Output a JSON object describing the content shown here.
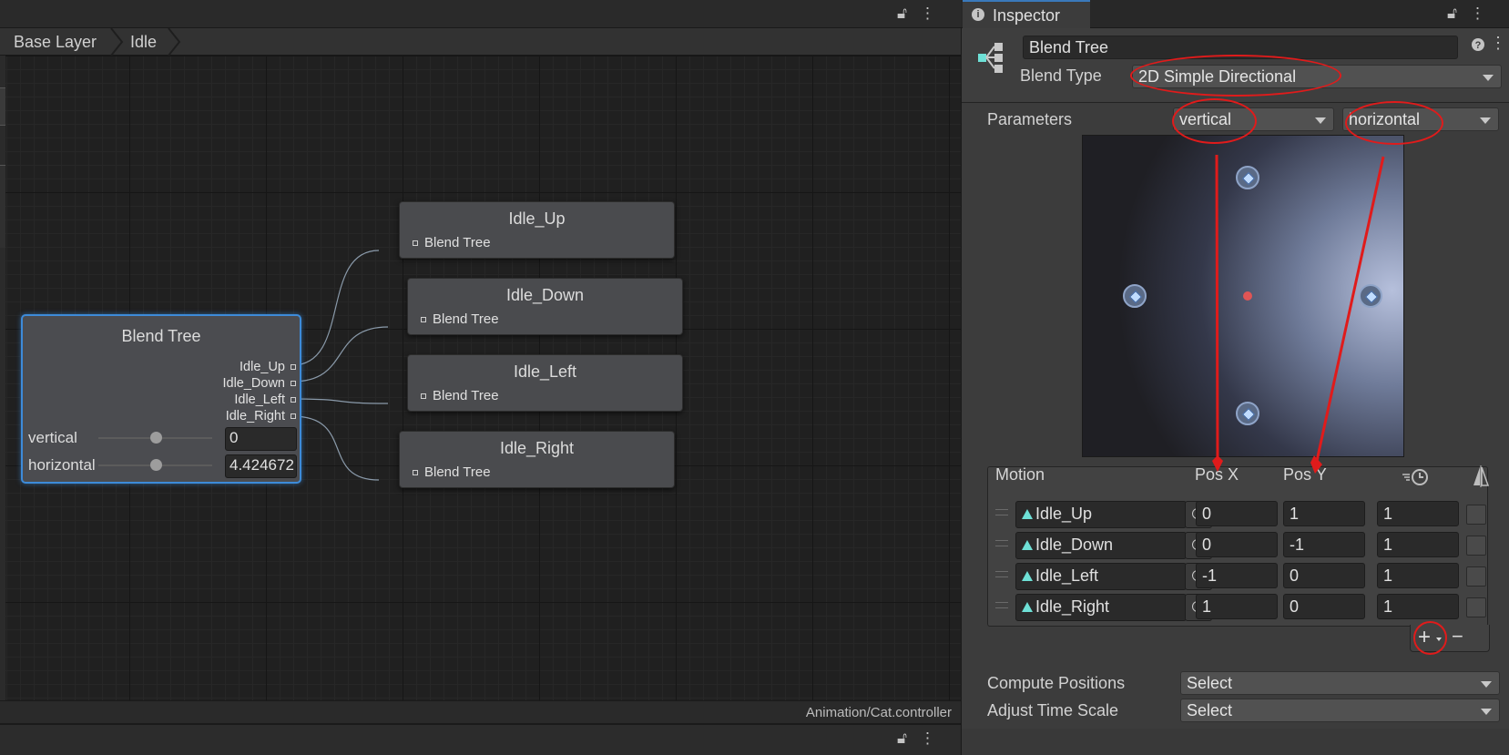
{
  "animator": {
    "breadcrumb": [
      "Base Layer",
      "Idle"
    ],
    "footer_path": "Animation/Cat.controller",
    "blend_tree_node": {
      "title": "Blend Tree",
      "outputs": [
        "Idle_Up",
        "Idle_Down",
        "Idle_Left",
        "Idle_Right"
      ],
      "params": [
        {
          "name": "vertical",
          "value": "0",
          "slider_fraction": 0.5
        },
        {
          "name": "horizontal",
          "value": "4.424672",
          "slider_fraction": 0.5
        }
      ]
    },
    "child_nodes": [
      {
        "title": "Idle_Up",
        "port": "Blend Tree"
      },
      {
        "title": "Idle_Down",
        "port": "Blend Tree"
      },
      {
        "title": "Idle_Left",
        "port": "Blend Tree"
      },
      {
        "title": "Idle_Right",
        "port": "Blend Tree"
      }
    ],
    "topbar_icons": [
      "lock-icon",
      "kebab-menu-icon"
    ]
  },
  "inspector": {
    "tab_label": "Inspector",
    "name_field": "Blend Tree",
    "blend_type_label": "Blend Type",
    "blend_type_value": "2D Simple Directional",
    "parameters_label": "Parameters",
    "param_x": "vertical",
    "param_y": "horizontal",
    "motion_headers": {
      "motion": "Motion",
      "pos_x": "Pos X",
      "pos_y": "Pos Y"
    },
    "motions": [
      {
        "name": "Idle_Up",
        "pos_x": "0",
        "pos_y": "1",
        "speed": "1"
      },
      {
        "name": "Idle_Down",
        "pos_x": "0",
        "pos_y": "-1",
        "speed": "1"
      },
      {
        "name": "Idle_Left",
        "pos_x": "-1",
        "pos_y": "0",
        "speed": "1"
      },
      {
        "name": "Idle_Right",
        "pos_x": "1",
        "pos_y": "0",
        "speed": "1"
      }
    ],
    "add_button": "+",
    "remove_button": "−",
    "compute_positions_label": "Compute Positions",
    "compute_positions_value": "Select",
    "adjust_time_scale_label": "Adjust Time Scale",
    "adjust_time_scale_value": "Select",
    "annotation_color": "#e01b1b",
    "accent_color": "#3d8bd9"
  }
}
